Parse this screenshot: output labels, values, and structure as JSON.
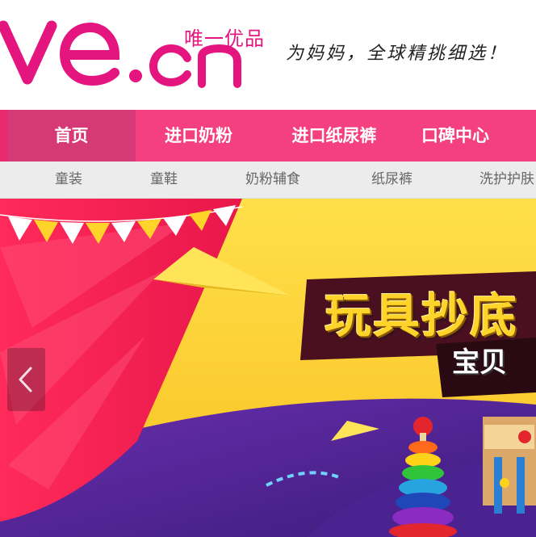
{
  "header": {
    "logo_text": "ve.cn",
    "brand_cn": "唯一优品",
    "slogan": "为妈妈，全球精挑细选！",
    "colors": {
      "brand_pink": "#e4157f"
    }
  },
  "main_nav": {
    "items": [
      {
        "label": "首页",
        "active": true
      },
      {
        "label": "进口奶粉",
        "active": false
      },
      {
        "label": "进口纸尿裤",
        "active": false
      },
      {
        "label": "口碑中心",
        "active": false
      }
    ],
    "colors": {
      "bg": "#f5407f",
      "active_bg": "#d63a76"
    }
  },
  "sub_nav": {
    "items": [
      {
        "label": "童装"
      },
      {
        "label": "童鞋"
      },
      {
        "label": "奶粉辅食"
      },
      {
        "label": "纸尿裤"
      },
      {
        "label": "洗护护肤"
      }
    ]
  },
  "banner": {
    "headline": "玩具抄底",
    "subheadline": "宝贝",
    "prev_icon": "chevron-left-icon"
  }
}
